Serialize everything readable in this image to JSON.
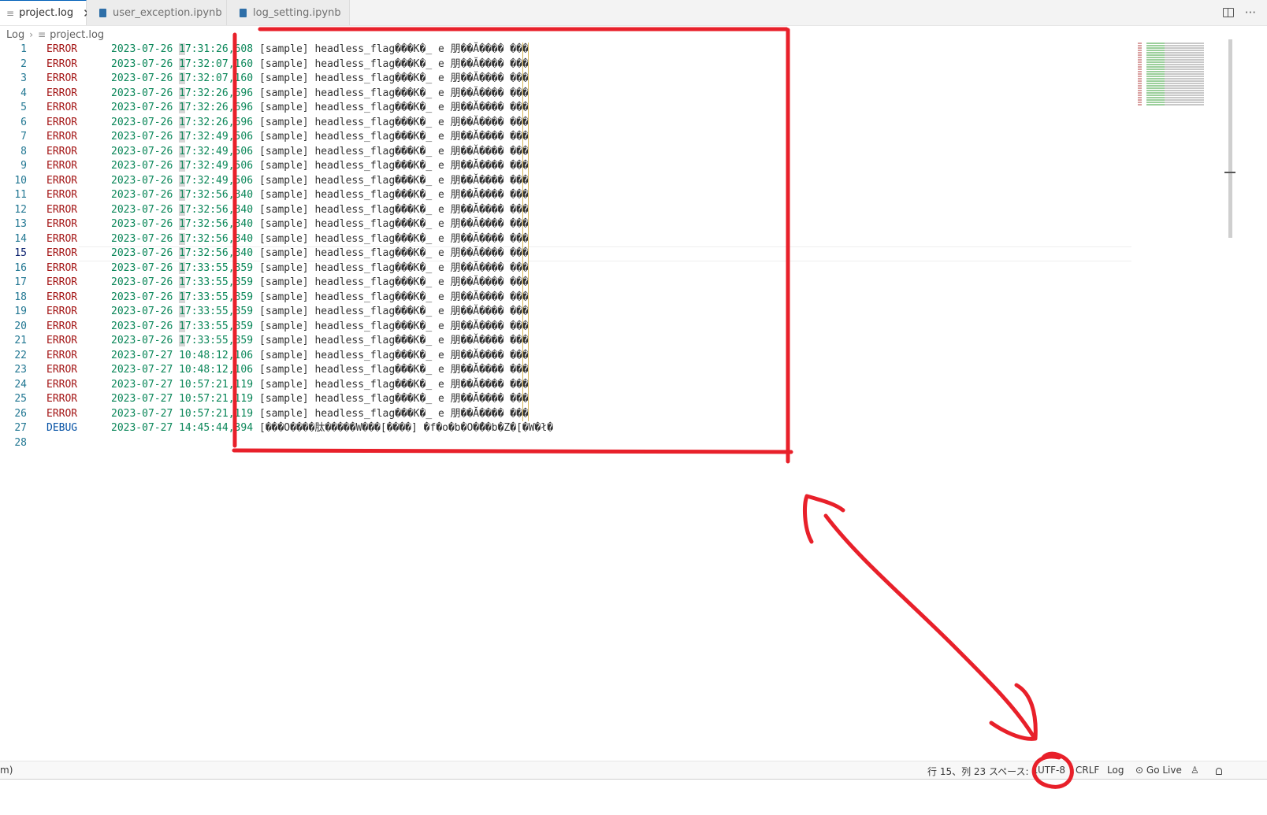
{
  "tabs": [
    {
      "label": "project.log",
      "icon": "file-lines-icon",
      "active": true
    },
    {
      "label": "user_exception.ipynb",
      "icon": "notebook-icon",
      "active": false
    },
    {
      "label": "log_setting.ipynb",
      "icon": "notebook-icon",
      "active": false
    }
  ],
  "tabbar": {
    "close_glyph": "✕",
    "more_glyph": "···"
  },
  "breadcrumb": {
    "root": "Log",
    "sep": "›",
    "file": "project.log"
  },
  "editor": {
    "current_line": 15,
    "lines": [
      {
        "n": "1",
        "level": "ERROR",
        "date": "2023-07-26 ",
        "hl": "1",
        "time": "7:31:26,",
        "ms": "608",
        "msg": "[sample] headless_flag���K�_ e 朋��Ă���� ���"
      },
      {
        "n": "2",
        "level": "ERROR",
        "date": "2023-07-26 ",
        "hl": "1",
        "time": "7:32:07,",
        "ms": "160",
        "msg": "[sample] headless_flag���K�_ e 朋��Ă���� ���"
      },
      {
        "n": "3",
        "level": "ERROR",
        "date": "2023-07-26 ",
        "hl": "1",
        "time": "7:32:07,",
        "ms": "160",
        "msg": "[sample] headless_flag���K�_ e 朋��Ă���� ���"
      },
      {
        "n": "4",
        "level": "ERROR",
        "date": "2023-07-26 ",
        "hl": "1",
        "time": "7:32:26,",
        "ms": "696",
        "msg": "[sample] headless_flag���K�_ e 朋��Ă���� ���"
      },
      {
        "n": "5",
        "level": "ERROR",
        "date": "2023-07-26 ",
        "hl": "1",
        "time": "7:32:26,",
        "ms": "696",
        "msg": "[sample] headless_flag���K�_ e 朋��Ă���� ���"
      },
      {
        "n": "6",
        "level": "ERROR",
        "date": "2023-07-26 ",
        "hl": "1",
        "time": "7:32:26,",
        "ms": "696",
        "msg": "[sample] headless_flag���K�_ e 朋��Ă���� ���"
      },
      {
        "n": "7",
        "level": "ERROR",
        "date": "2023-07-26 ",
        "hl": "1",
        "time": "7:32:49,",
        "ms": "506",
        "msg": "[sample] headless_flag���K�_ e 朋��Ă���� ���"
      },
      {
        "n": "8",
        "level": "ERROR",
        "date": "2023-07-26 ",
        "hl": "1",
        "time": "7:32:49,",
        "ms": "506",
        "msg": "[sample] headless_flag���K�_ e 朋��Ă���� ���"
      },
      {
        "n": "9",
        "level": "ERROR",
        "date": "2023-07-26 ",
        "hl": "1",
        "time": "7:32:49,",
        "ms": "506",
        "msg": "[sample] headless_flag���K�_ e 朋��Ă���� ���"
      },
      {
        "n": "10",
        "level": "ERROR",
        "date": "2023-07-26 ",
        "hl": "1",
        "time": "7:32:49,",
        "ms": "506",
        "msg": "[sample] headless_flag���K�_ e 朋��Ă���� ���"
      },
      {
        "n": "11",
        "level": "ERROR",
        "date": "2023-07-26 ",
        "hl": "1",
        "time": "7:32:56,",
        "ms": "840",
        "msg": "[sample] headless_flag���K�_ e 朋��Ă���� ���"
      },
      {
        "n": "12",
        "level": "ERROR",
        "date": "2023-07-26 ",
        "hl": "1",
        "time": "7:32:56,",
        "ms": "840",
        "msg": "[sample] headless_flag���K�_ e 朋��Ă���� ���"
      },
      {
        "n": "13",
        "level": "ERROR",
        "date": "2023-07-26 ",
        "hl": "1",
        "time": "7:32:56,",
        "ms": "840",
        "msg": "[sample] headless_flag���K�_ e 朋��Ă���� ���"
      },
      {
        "n": "14",
        "level": "ERROR",
        "date": "2023-07-26 ",
        "hl": "1",
        "time": "7:32:56,",
        "ms": "840",
        "msg": "[sample] headless_flag���K�_ e 朋��Ă���� ���"
      },
      {
        "n": "15",
        "level": "ERROR",
        "date": "2023-07-26 ",
        "hl": "1",
        "time": "7:32:56,",
        "ms": "840",
        "msg": "[sample] headless_flag���K�_ e 朋��Ă���� ���"
      },
      {
        "n": "16",
        "level": "ERROR",
        "date": "2023-07-26 ",
        "hl": "1",
        "time": "7:33:55,",
        "ms": "859",
        "msg": "[sample] headless_flag���K�_ e 朋��Ă���� ���"
      },
      {
        "n": "17",
        "level": "ERROR",
        "date": "2023-07-26 ",
        "hl": "1",
        "time": "7:33:55,",
        "ms": "859",
        "msg": "[sample] headless_flag���K�_ e 朋��Ă���� ���"
      },
      {
        "n": "18",
        "level": "ERROR",
        "date": "2023-07-26 ",
        "hl": "1",
        "time": "7:33:55,",
        "ms": "859",
        "msg": "[sample] headless_flag���K�_ e 朋��Ă���� ���"
      },
      {
        "n": "19",
        "level": "ERROR",
        "date": "2023-07-26 ",
        "hl": "1",
        "time": "7:33:55,",
        "ms": "859",
        "msg": "[sample] headless_flag���K�_ e 朋��Ă���� ���"
      },
      {
        "n": "20",
        "level": "ERROR",
        "date": "2023-07-26 ",
        "hl": "1",
        "time": "7:33:55,",
        "ms": "859",
        "msg": "[sample] headless_flag���K�_ e 朋��Ă���� ���"
      },
      {
        "n": "21",
        "level": "ERROR",
        "date": "2023-07-26 ",
        "hl": "1",
        "time": "7:33:55,",
        "ms": "859",
        "msg": "[sample] headless_flag���K�_ e 朋��Ă���� ���"
      },
      {
        "n": "22",
        "level": "ERROR",
        "date": "2023-07-27 ",
        "hl": "",
        "time": "10:48:12,",
        "ms": "106",
        "msg": "[sample] headless_flag���K�_ e 朋��Ă���� ���"
      },
      {
        "n": "23",
        "level": "ERROR",
        "date": "2023-07-27 ",
        "hl": "",
        "time": "10:48:12,",
        "ms": "106",
        "msg": "[sample] headless_flag���K�_ e 朋��Ă���� ���"
      },
      {
        "n": "24",
        "level": "ERROR",
        "date": "2023-07-27 ",
        "hl": "",
        "time": "10:57:21,",
        "ms": "119",
        "msg": "[sample] headless_flag���K�_ e 朋��Ă���� ���"
      },
      {
        "n": "25",
        "level": "ERROR",
        "date": "2023-07-27 ",
        "hl": "",
        "time": "10:57:21,",
        "ms": "119",
        "msg": "[sample] headless_flag���K�_ e 朋��Ă���� ���"
      },
      {
        "n": "26",
        "level": "ERROR",
        "date": "2023-07-27 ",
        "hl": "",
        "time": "10:57:21,",
        "ms": "119",
        "msg": "[sample] headless_flag���K�_ e 朋��Ă���� ���"
      },
      {
        "n": "27",
        "level": "DEBUG",
        "date": "2023-07-27 ",
        "hl": "",
        "time": "14:45:44,",
        "ms": "394",
        "msg": "[���O����肽�����W���[����] �f�o�b�O�̃��b�Z�[�W�ł�"
      },
      {
        "n": "28",
        "level": "",
        "date": "",
        "hl": "",
        "time": "",
        "ms": "",
        "msg": ""
      }
    ]
  },
  "statusbar": {
    "left": "m)",
    "position": "行 15、列 23",
    "spaces": "スペース: 4",
    "encoding": "UTF-8",
    "eol": "CRLF",
    "language": "Log",
    "golive": "Go Live"
  },
  "colors": {
    "annotation": "#e8202a",
    "error": "#a31515",
    "debug": "#0451a5",
    "timestamp": "#098658"
  }
}
